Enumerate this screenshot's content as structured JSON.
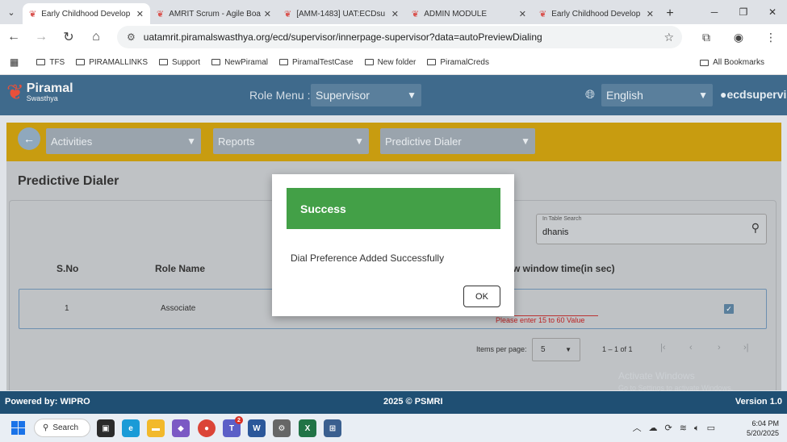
{
  "browser": {
    "tabs": [
      {
        "label": "Early Childhood Develop",
        "active": true
      },
      {
        "label": "AMRIT Scrum - Agile Boa",
        "active": false
      },
      {
        "label": "[AMM-1483] UAT:ECDsu",
        "active": false
      },
      {
        "label": "ADMIN MODULE",
        "active": false
      },
      {
        "label": "Early Childhood Develop",
        "active": false
      }
    ],
    "url": "uatamrit.piramalswasthya.org/ecd/supervisor/innerpage-supervisor?data=autoPreviewDialing",
    "bookmarks": [
      "TFS",
      "PIRAMALLINKS",
      "Support",
      "NewPiramal",
      "PiramalTestCase",
      "New folder",
      "PiramalCreds"
    ],
    "all_bookmarks": "All Bookmarks"
  },
  "header": {
    "logo_main": "Piramal",
    "logo_sub": "Swasthya",
    "role_menu_label": "Role Menu :",
    "role_value": "Supervisor",
    "language": "English",
    "user": "ecdsupervis"
  },
  "toolbar": {
    "activities": "Activities",
    "reports": "Reports",
    "predictive_dialer": "Predictive Dialer"
  },
  "page": {
    "title": "Predictive Dialer",
    "search_label": "In Table Search",
    "search_value": "dhanis",
    "columns": [
      "S.No",
      "Role Name",
      "w window time(in sec)"
    ],
    "rows": [
      {
        "sno": "1",
        "role": "Associate",
        "error": "Please enter 15 to 60 Value",
        "checked": true
      }
    ],
    "items_per_page_label": "Items per page:",
    "items_per_page": "5",
    "range": "1 – 1 of 1",
    "watermark_1": "Activate Windows",
    "watermark_2": "Go to Settings to activate Windows."
  },
  "footer": {
    "powered": "Powered by: WIPRO",
    "copyright": "2025 © PSMRI",
    "version": "Version 1.0"
  },
  "modal": {
    "title": "Success",
    "message": "Dial Preference Added Successfully",
    "ok": "OK"
  },
  "taskbar": {
    "search": "Search",
    "time": "6:04 PM",
    "date": "5/20/2025",
    "teams_badge": "2"
  },
  "colors": {
    "header_blue": "#3f6a8c",
    "toolbar_yellow": "#c89c10",
    "success_green": "#43a047",
    "footer_blue": "#1f4f73",
    "error_red": "#b22222"
  }
}
